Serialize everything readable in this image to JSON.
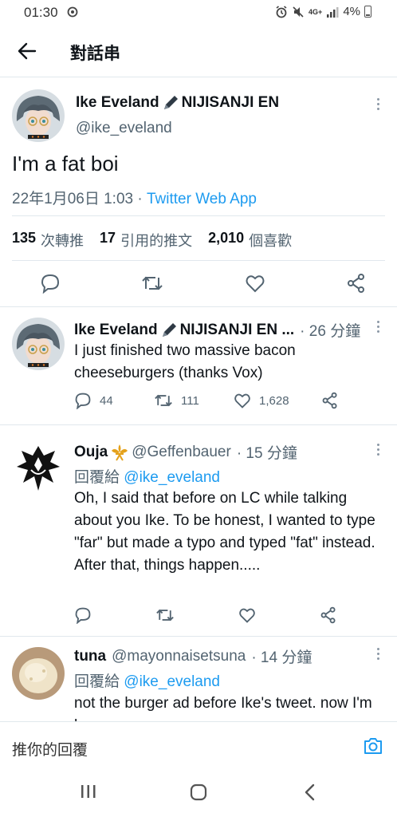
{
  "status_bar": {
    "time": "01:30",
    "network": "4G+",
    "battery": "4%"
  },
  "header": {
    "title": "對話串"
  },
  "main_tweet": {
    "name": "Ike Eveland",
    "name_suffix": "NIJISANJI EN",
    "handle": "@ike_eveland",
    "text": "I'm a fat boi",
    "timestamp": "22年1月06日 1:03 · ",
    "app": "Twitter Web App",
    "retweets_count": "135",
    "retweets_label": "次轉推",
    "quotes_count": "17",
    "quotes_label": "引用的推文",
    "likes_count": "2,010",
    "likes_label": "個喜歡"
  },
  "replies": [
    {
      "name": "Ike Eveland",
      "name_suffix": "NIJISANJI EN ...",
      "meta": "· 26 分鐘",
      "text": "I just finished two massive bacon cheeseburgers (thanks Vox)",
      "reply_count": "44",
      "retweet_count": "111",
      "like_count": "1,628"
    },
    {
      "name": "Ouja",
      "handle": "@Geffenbauer",
      "meta": "· 15 分鐘",
      "reply_to_label": "回覆給",
      "reply_to_handle": "@ike_eveland",
      "text": "Oh, I said that before on LC while talking about you Ike. To be honest, I wanted to type \"far\" but made a typo and typed \"fat\" instead. After that, things happen....."
    },
    {
      "name": "tuna",
      "handle": "@mayonnaisetsuna",
      "meta": "· 14 分鐘",
      "reply_to_label": "回覆給",
      "reply_to_handle": "@ike_eveland",
      "text": "not the burger ad before Ike's tweet. now I'm hungry"
    }
  ],
  "composer": {
    "placeholder": "推你的回覆"
  },
  "colors": {
    "accent": "#1d9bf0",
    "text": "#0f1419",
    "secondary": "#536471",
    "divider": "#e1e8ed"
  }
}
